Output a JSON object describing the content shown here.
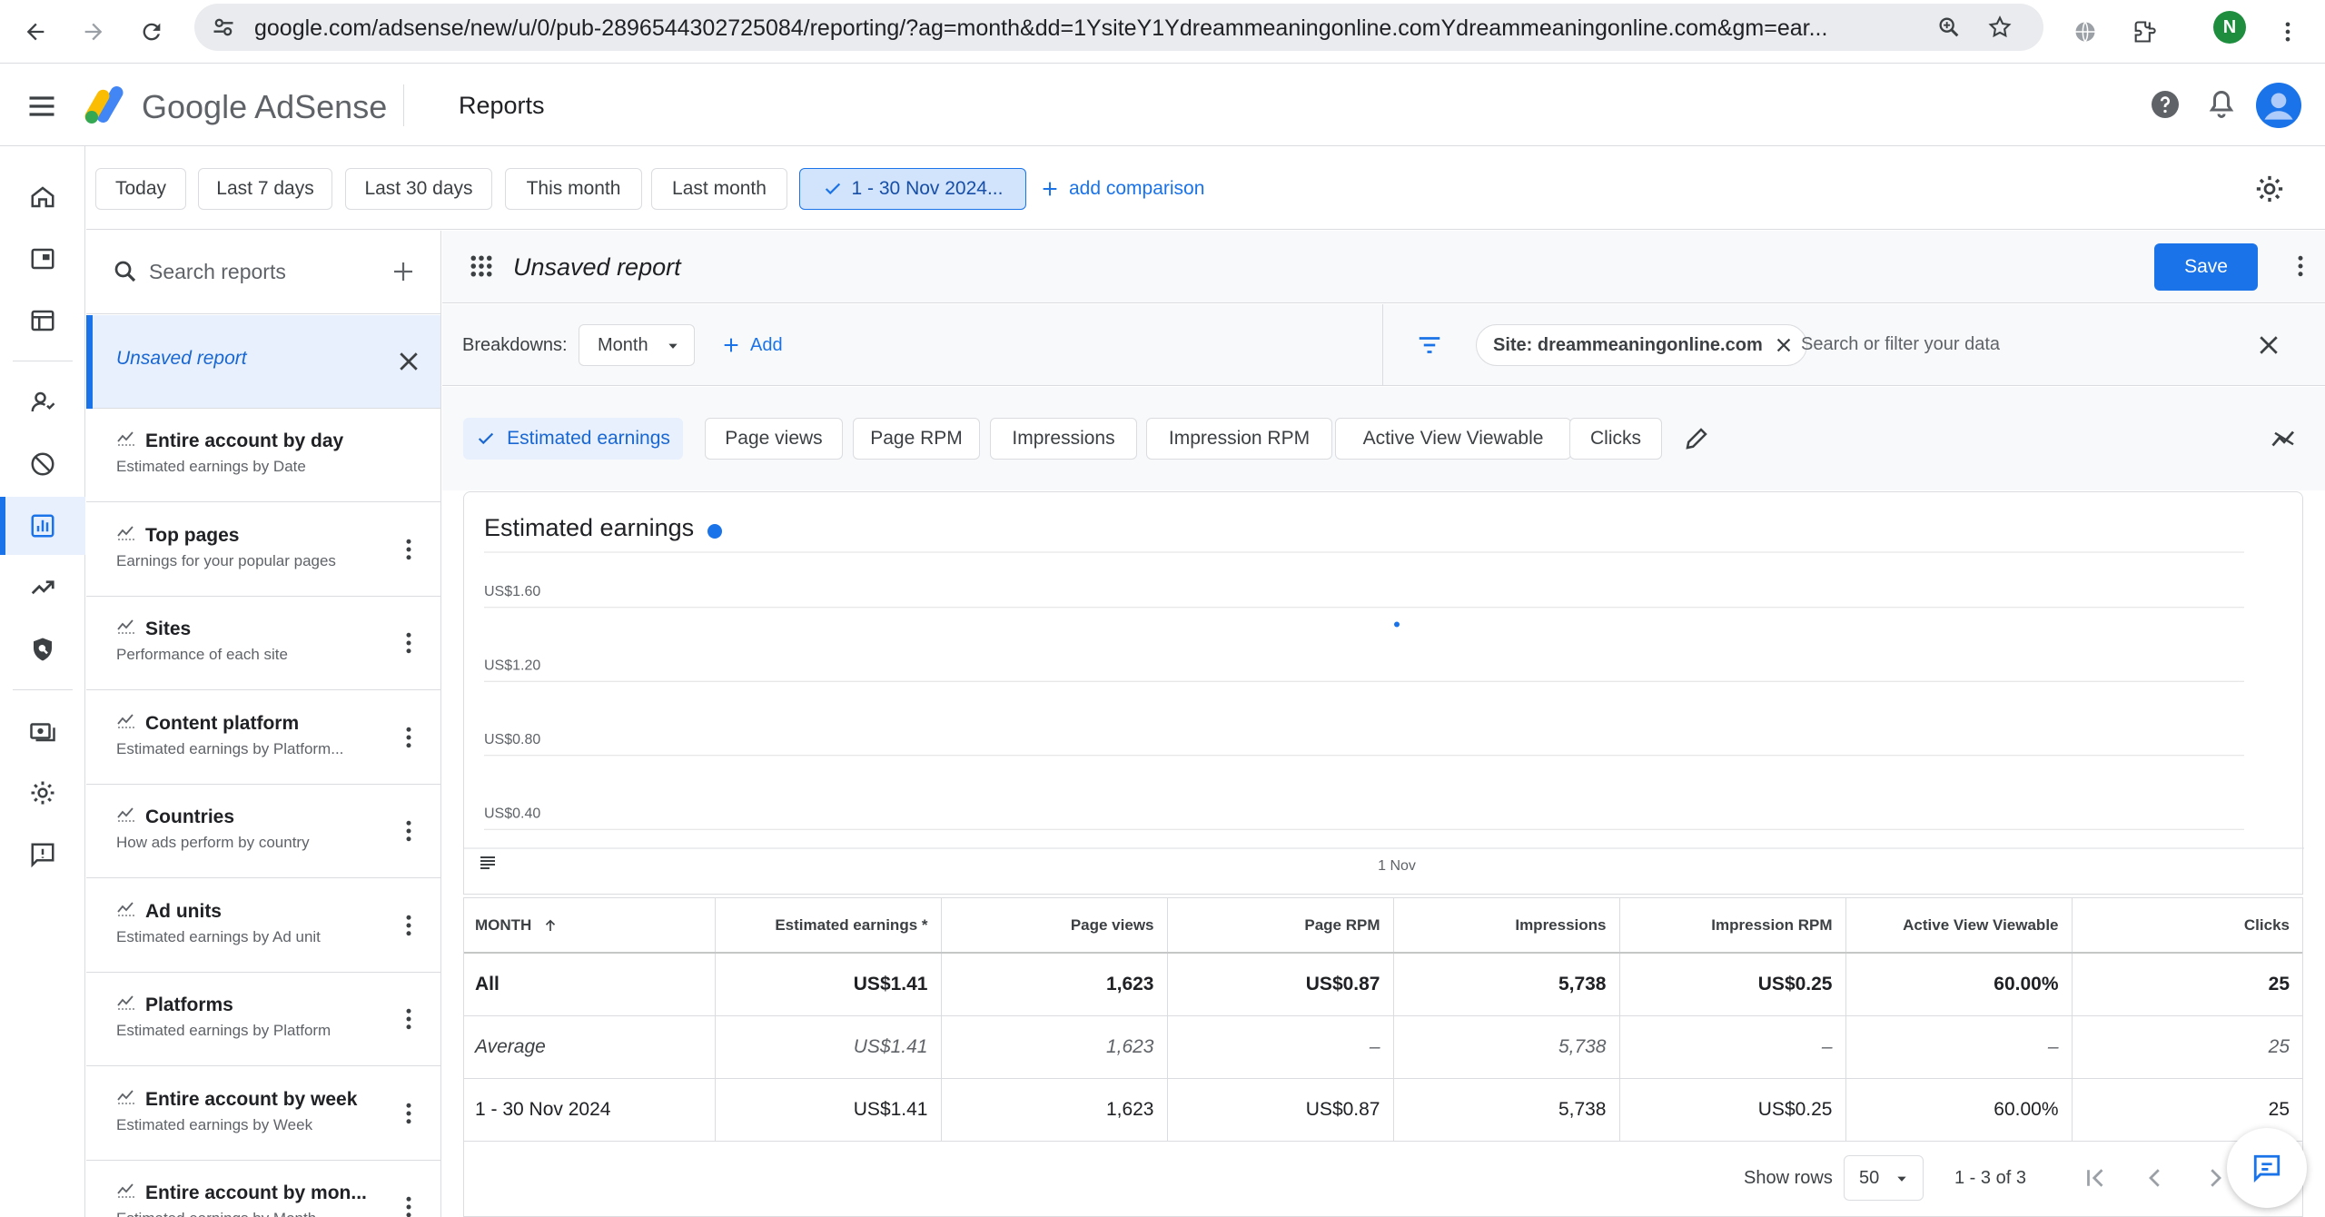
{
  "browser": {
    "url": "google.com/adsense/new/u/0/pub-2896544302725084/reporting/?ag=month&dd=1YsiteY1Ydreammeaningonline.comYdreammeaningonline.com&gm=ear...",
    "profile_initial": "N"
  },
  "header": {
    "app_name": "Google AdSense",
    "page_title": "Reports"
  },
  "date_bar": {
    "chips": [
      "Today",
      "Last 7 days",
      "Last 30 days",
      "This month",
      "Last month"
    ],
    "selected_range": "1 - 30 Nov 2024...",
    "add_comparison": "add comparison"
  },
  "sidebar": {
    "search_placeholder": "Search reports",
    "active_report": "Unsaved report",
    "reports": [
      {
        "title": "Entire account by day",
        "subtitle": "Estimated earnings by Date"
      },
      {
        "title": "Top pages",
        "subtitle": "Earnings for your popular pages"
      },
      {
        "title": "Sites",
        "subtitle": "Performance of each site"
      },
      {
        "title": "Content platform",
        "subtitle": "Estimated earnings by Platform..."
      },
      {
        "title": "Countries",
        "subtitle": "How ads perform by country"
      },
      {
        "title": "Ad units",
        "subtitle": "Estimated earnings by Ad unit"
      },
      {
        "title": "Platforms",
        "subtitle": "Estimated earnings by Platform"
      },
      {
        "title": "Entire account by week",
        "subtitle": "Estimated earnings by Week"
      },
      {
        "title": "Entire account by mon...",
        "subtitle": "Estimated earnings by Month"
      }
    ]
  },
  "report": {
    "name": "Unsaved report",
    "save_label": "Save",
    "breakdowns_label": "Breakdowns:",
    "breakdown_value": "Month",
    "add_label": "Add",
    "filter_chip": "Site: dreammeaningonline.com",
    "filter_placeholder": "Search or filter your data",
    "metrics": [
      "Estimated earnings",
      "Page views",
      "Page RPM",
      "Impressions",
      "Impression RPM",
      "Active View Viewable",
      "Clicks"
    ]
  },
  "chart_data": {
    "type": "line",
    "title": "Estimated earnings",
    "x": [
      "1 Nov"
    ],
    "series": [
      {
        "values": [
          1.41
        ]
      }
    ],
    "y_ticks": [
      "US$1.60",
      "US$1.20",
      "US$0.80",
      "US$0.40"
    ],
    "ylim": [
      0.2,
      1.8
    ],
    "grid": true,
    "color": "#1a73e8"
  },
  "table": {
    "columns": [
      "MONTH",
      "Estimated earnings *",
      "Page views",
      "Page RPM",
      "Impressions",
      "Impression RPM",
      "Active View Viewable",
      "Clicks"
    ],
    "rows": [
      {
        "kind": "total",
        "cells": [
          "All",
          "US$1.41",
          "1,623",
          "US$0.87",
          "5,738",
          "US$0.25",
          "60.00%",
          "25"
        ]
      },
      {
        "kind": "avg",
        "cells": [
          "Average",
          "US$1.41",
          "1,623",
          "–",
          "5,738",
          "–",
          "–",
          "25"
        ]
      },
      {
        "kind": "row",
        "cells": [
          "1 - 30 Nov 2024",
          "US$1.41",
          "1,623",
          "US$0.87",
          "5,738",
          "US$0.25",
          "60.00%",
          "25"
        ]
      }
    ]
  },
  "pager": {
    "show_rows_label": "Show rows",
    "rows_value": "50",
    "range": "1 - 3 of 3"
  }
}
